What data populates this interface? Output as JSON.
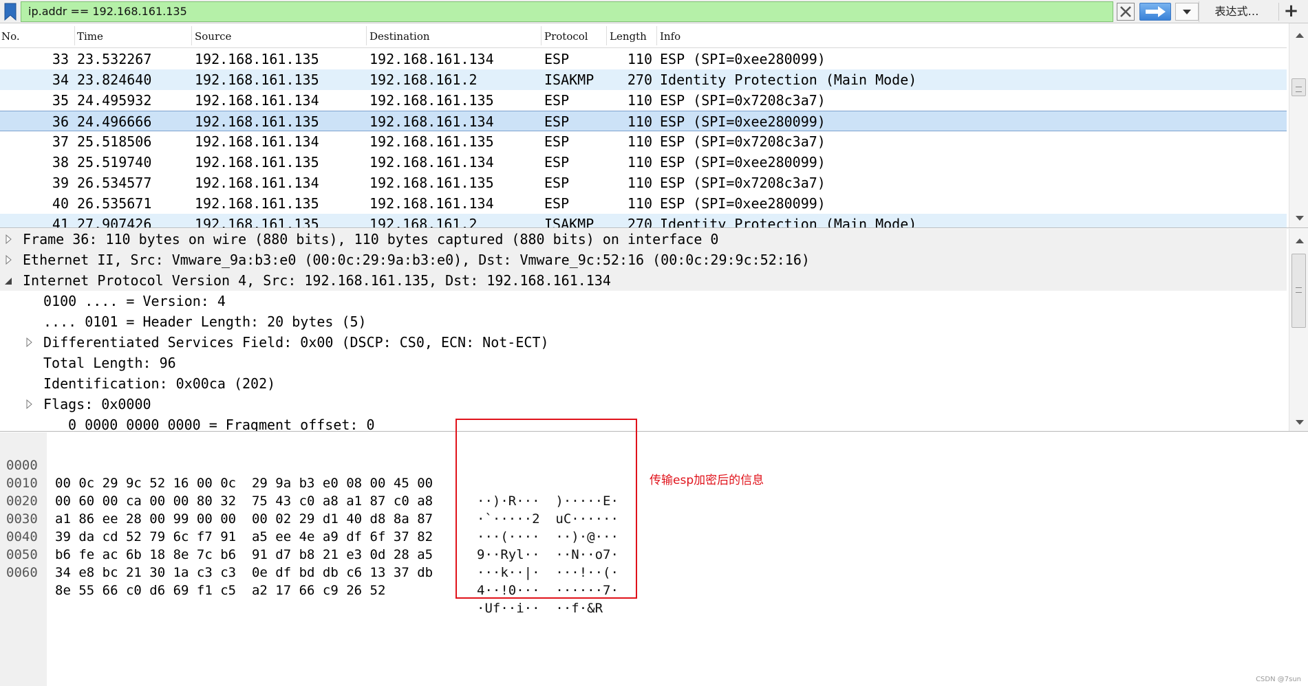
{
  "filter": {
    "value": "ip.addr == 192.168.161.135",
    "expression_label": "表达式…",
    "add_label": "+"
  },
  "columns": [
    "No.",
    "Time",
    "Source",
    "Destination",
    "Protocol",
    "Length",
    "Info"
  ],
  "packets": [
    {
      "no": "33",
      "time": "23.532267",
      "src": "192.168.161.135",
      "dst": "192.168.161.134",
      "proto": "ESP",
      "len": "110",
      "info": "ESP (SPI=0xee280099)"
    },
    {
      "no": "34",
      "time": "23.824640",
      "src": "192.168.161.135",
      "dst": "192.168.161.2",
      "proto": "ISAKMP",
      "len": "270",
      "info": "Identity Protection (Main Mode)"
    },
    {
      "no": "35",
      "time": "24.495932",
      "src": "192.168.161.134",
      "dst": "192.168.161.135",
      "proto": "ESP",
      "len": "110",
      "info": "ESP (SPI=0x7208c3a7)"
    },
    {
      "no": "36",
      "time": "24.496666",
      "src": "192.168.161.135",
      "dst": "192.168.161.134",
      "proto": "ESP",
      "len": "110",
      "info": "ESP (SPI=0xee280099)"
    },
    {
      "no": "37",
      "time": "25.518506",
      "src": "192.168.161.134",
      "dst": "192.168.161.135",
      "proto": "ESP",
      "len": "110",
      "info": "ESP (SPI=0x7208c3a7)"
    },
    {
      "no": "38",
      "time": "25.519740",
      "src": "192.168.161.135",
      "dst": "192.168.161.134",
      "proto": "ESP",
      "len": "110",
      "info": "ESP (SPI=0xee280099)"
    },
    {
      "no": "39",
      "time": "26.534577",
      "src": "192.168.161.134",
      "dst": "192.168.161.135",
      "proto": "ESP",
      "len": "110",
      "info": "ESP (SPI=0x7208c3a7)"
    },
    {
      "no": "40",
      "time": "26.535671",
      "src": "192.168.161.135",
      "dst": "192.168.161.134",
      "proto": "ESP",
      "len": "110",
      "info": "ESP (SPI=0xee280099)"
    },
    {
      "no": "41",
      "time": "27.907426",
      "src": "192.168.161.135",
      "dst": "192.168.161.2",
      "proto": "ISAKMP",
      "len": "270",
      "info": "Identity Protection (Main Mode)"
    }
  ],
  "details": [
    {
      "text": "Frame 36: 110 bytes on wire (880 bits), 110 bytes captured (880 bits) on interface 0",
      "level": 0,
      "expander": "collapsed"
    },
    {
      "text": "Ethernet II, Src: Vmware_9a:b3:e0 (00:0c:29:9a:b3:e0), Dst: Vmware_9c:52:16 (00:0c:29:9c:52:16)",
      "level": 0,
      "expander": "collapsed"
    },
    {
      "text": "Internet Protocol Version 4, Src: 192.168.161.135, Dst: 192.168.161.134",
      "level": 0,
      "expander": "expanded"
    },
    {
      "text": "0100 .... = Version: 4",
      "level": 1,
      "expander": "none"
    },
    {
      "text": ".... 0101 = Header Length: 20 bytes (5)",
      "level": 1,
      "expander": "none"
    },
    {
      "text": "Differentiated Services Field: 0x00 (DSCP: CS0, ECN: Not-ECT)",
      "level": 1,
      "expander": "collapsed"
    },
    {
      "text": "Total Length: 96",
      "level": 1,
      "expander": "none"
    },
    {
      "text": "Identification: 0x00ca (202)",
      "level": 1,
      "expander": "none"
    },
    {
      "text": "Flags: 0x0000",
      "level": 1,
      "expander": "collapsed"
    },
    {
      "text": "0 0000 0000 0000 = Fragment offset: 0",
      "level": 2,
      "expander": "none"
    }
  ],
  "bytes": [
    {
      "offset": "0000",
      "hex": "00 0c 29 9c 52 16 00 0c  29 9a b3 e0 08 00 45 00",
      "ascii": "··)·R···  )·····E·"
    },
    {
      "offset": "0010",
      "hex": "00 60 00 ca 00 00 80 32  75 43 c0 a8 a1 87 c0 a8",
      "ascii": "·`·····2  uC······"
    },
    {
      "offset": "0020",
      "hex": "a1 86 ee 28 00 99 00 00  00 02 29 d1 40 d8 8a 87",
      "ascii": "···(····  ··)·@···"
    },
    {
      "offset": "0030",
      "hex": "39 da cd 52 79 6c f7 91  a5 ee 4e a9 df 6f 37 82",
      "ascii": "9··Ryl··  ··N··o7·"
    },
    {
      "offset": "0040",
      "hex": "b6 fe ac 6b 18 8e 7c b6  91 d7 b8 21 e3 0d 28 a5",
      "ascii": "···k··|·  ···!··(·"
    },
    {
      "offset": "0050",
      "hex": "34 e8 bc 21 30 1a c3 c3  0e df bd db c6 13 37 db",
      "ascii": "4··!0···  ······7·"
    },
    {
      "offset": "0060",
      "hex": "8e 55 66 c0 d6 69 f1 c5  a2 17 66 c9 26 52",
      "ascii": "·Uf··i··  ··f·&R"
    }
  ],
  "annotation": "传输esp加密后的信息",
  "watermark": "CSDN @7sun",
  "colors": {
    "filter_ok": "#b5f0a8",
    "isakmp_row": "#e1f0fb",
    "selected_row": "#cce2f7",
    "annotation_red": "#e0121a"
  },
  "icons": {
    "bookmark": "bookmark-icon",
    "clear": "clear-x-icon",
    "apply": "arrow-right-icon",
    "dropdown": "chevron-down-icon"
  },
  "selected_packet": "36"
}
